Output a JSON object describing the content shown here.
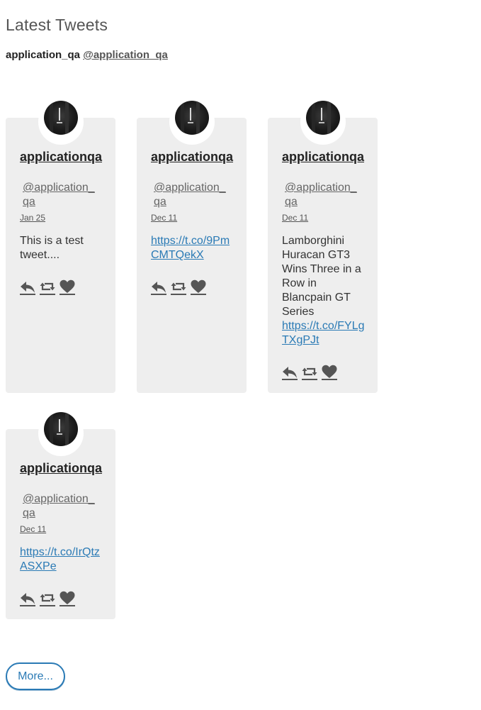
{
  "widget": {
    "title": "Latest Tweets"
  },
  "account": {
    "name": "application_qa",
    "handle": "@application_qa"
  },
  "tweets": [
    {
      "name": "applicationqa",
      "handle": "@application_qa",
      "date": "Jan 25",
      "text": "This is a test tweet....",
      "link": ""
    },
    {
      "name": "applicationqa",
      "handle": "@application_qa",
      "date": "Dec 11",
      "text": "",
      "link": "https://t.co/9PmCMTQekX"
    },
    {
      "name": "applicationqa",
      "handle": "@application_qa",
      "date": "Dec 11",
      "text": "Lamborghini Huracan GT3 Wins Three in a Row in Blancpain GT Series",
      "link": "https://t.co/FYLgTXgPJt"
    },
    {
      "name": "applicationqa",
      "handle": "@application_qa",
      "date": "Dec 11",
      "text": "",
      "link": "https://t.co/IrQtzASXPe"
    }
  ],
  "actions": {
    "reply_icon": "reply-icon",
    "retweet_icon": "retweet-icon",
    "like_icon": "heart-icon",
    "icon_color": "#555555"
  },
  "more_button": {
    "label": "More..."
  },
  "colors": {
    "link": "#2a7ab5",
    "card_background": "#eeeeee"
  }
}
